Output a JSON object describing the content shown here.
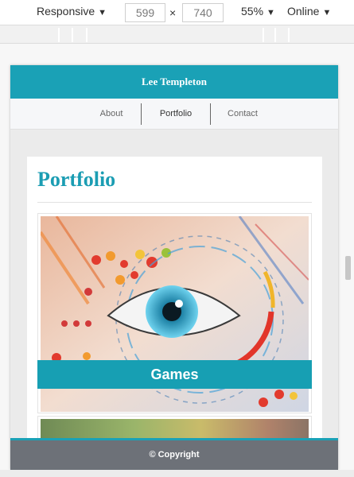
{
  "toolbar": {
    "device": "Responsive",
    "width": "599",
    "height": "740",
    "times": "×",
    "zoom": "55%",
    "network": "Online",
    "caret": "▼"
  },
  "site": {
    "title": "Lee Templeton",
    "nav": [
      {
        "label": "About"
      },
      {
        "label": "Portfolio"
      },
      {
        "label": "Contact"
      }
    ],
    "section_title": "Portfolio",
    "tiles": [
      {
        "label": "Games"
      }
    ],
    "footer": "© Copyright"
  },
  "colors": {
    "accent": "#1aa1b6",
    "footer": "#6d7178"
  }
}
